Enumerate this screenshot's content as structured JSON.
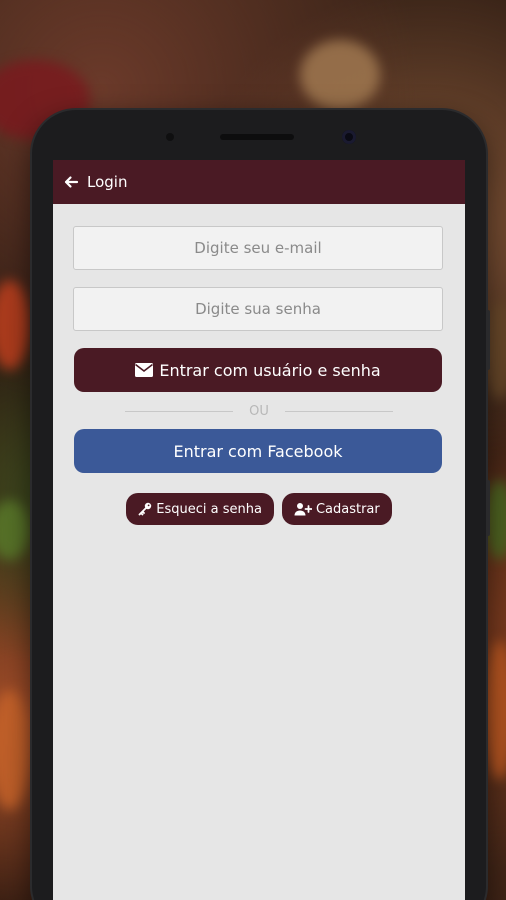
{
  "appbar": {
    "title": "Login",
    "back_icon": "arrow-left-icon"
  },
  "login": {
    "email_placeholder": "Digite seu e-mail",
    "password_placeholder": "Digite sua senha",
    "submit_label": "Entrar com usuário e senha",
    "divider_text": "OU",
    "facebook_label": "Entrar com Facebook",
    "forgot_label": "Esqueci a senha",
    "register_label": "Cadastrar"
  },
  "colors": {
    "primary": "#4a1a24",
    "facebook": "#3b5998",
    "background": "#e6e6e6"
  }
}
